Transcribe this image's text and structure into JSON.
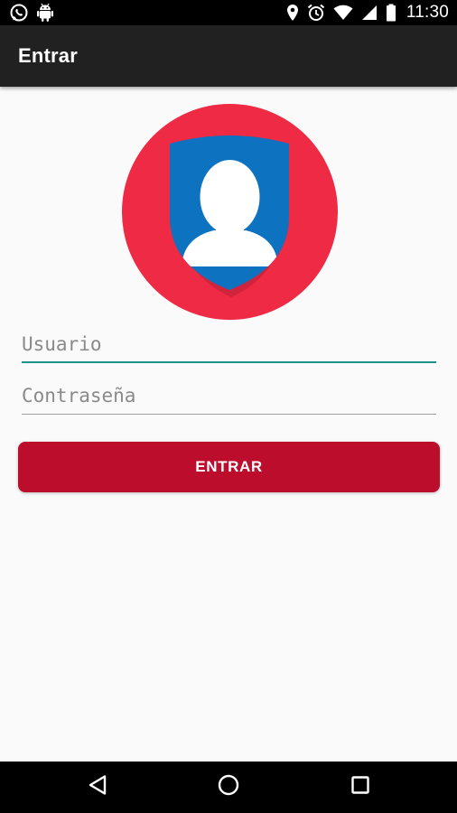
{
  "status_bar": {
    "time": "11:30",
    "icons": [
      "whatsapp-icon",
      "android-icon",
      "location-icon",
      "alarm-icon",
      "wifi-icon",
      "signal-icon",
      "battery-icon"
    ]
  },
  "app_bar": {
    "title": "Entrar"
  },
  "login": {
    "username_placeholder": "Usuario",
    "username_value": "",
    "password_placeholder": "Contraseña",
    "password_value": "",
    "submit_label": "ENTRAR"
  },
  "logo": {
    "icon": "user-shield-icon"
  },
  "nav_bar": {
    "icons": [
      "back-icon",
      "home-icon",
      "recents-icon"
    ]
  },
  "colors": {
    "accent": "#1a9386",
    "button": "#bd0d2d",
    "logo_circle": "#ee2a45",
    "shield": "#0d72bf",
    "app_bar": "#212121",
    "background": "#fafafa"
  }
}
